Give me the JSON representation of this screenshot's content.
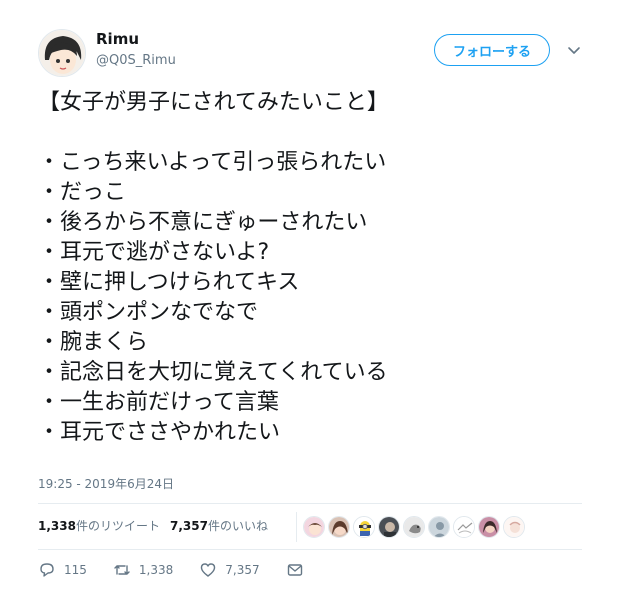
{
  "user": {
    "name": "Rimu",
    "handle": "@Q0S_Rimu"
  },
  "follow_button": "フォローする",
  "tweet": {
    "title": "【女子が男子にされてみたいこと】",
    "items": [
      "・こっち来いよって引っ張られたい",
      "・だっこ",
      "・後ろから不意にぎゅーされたい",
      "・耳元で逃がさないよ?",
      "・壁に押しつけられてキス",
      "・頭ポンポンなでなで",
      "・腕まくら",
      "・記念日を大切に覚えてくれている",
      "・一生お前だけって言葉",
      "・耳元でささやかれたい"
    ]
  },
  "timestamp": "19:25 - 2019年6月24日",
  "stats": {
    "retweets_count": "1,338",
    "retweets_label": "件のリツイート",
    "likes_count": "7,357",
    "likes_label": "件のいいね"
  },
  "actions": {
    "replies": "115",
    "retweets": "1,338",
    "likes": "7,357"
  },
  "colors": {
    "accent": "#1da1f2",
    "secondary_text": "#657786",
    "divider": "#e6ecf0"
  },
  "icons": [
    "chevron-down-icon",
    "reply-icon",
    "retweet-icon",
    "like-icon",
    "dm-icon"
  ]
}
